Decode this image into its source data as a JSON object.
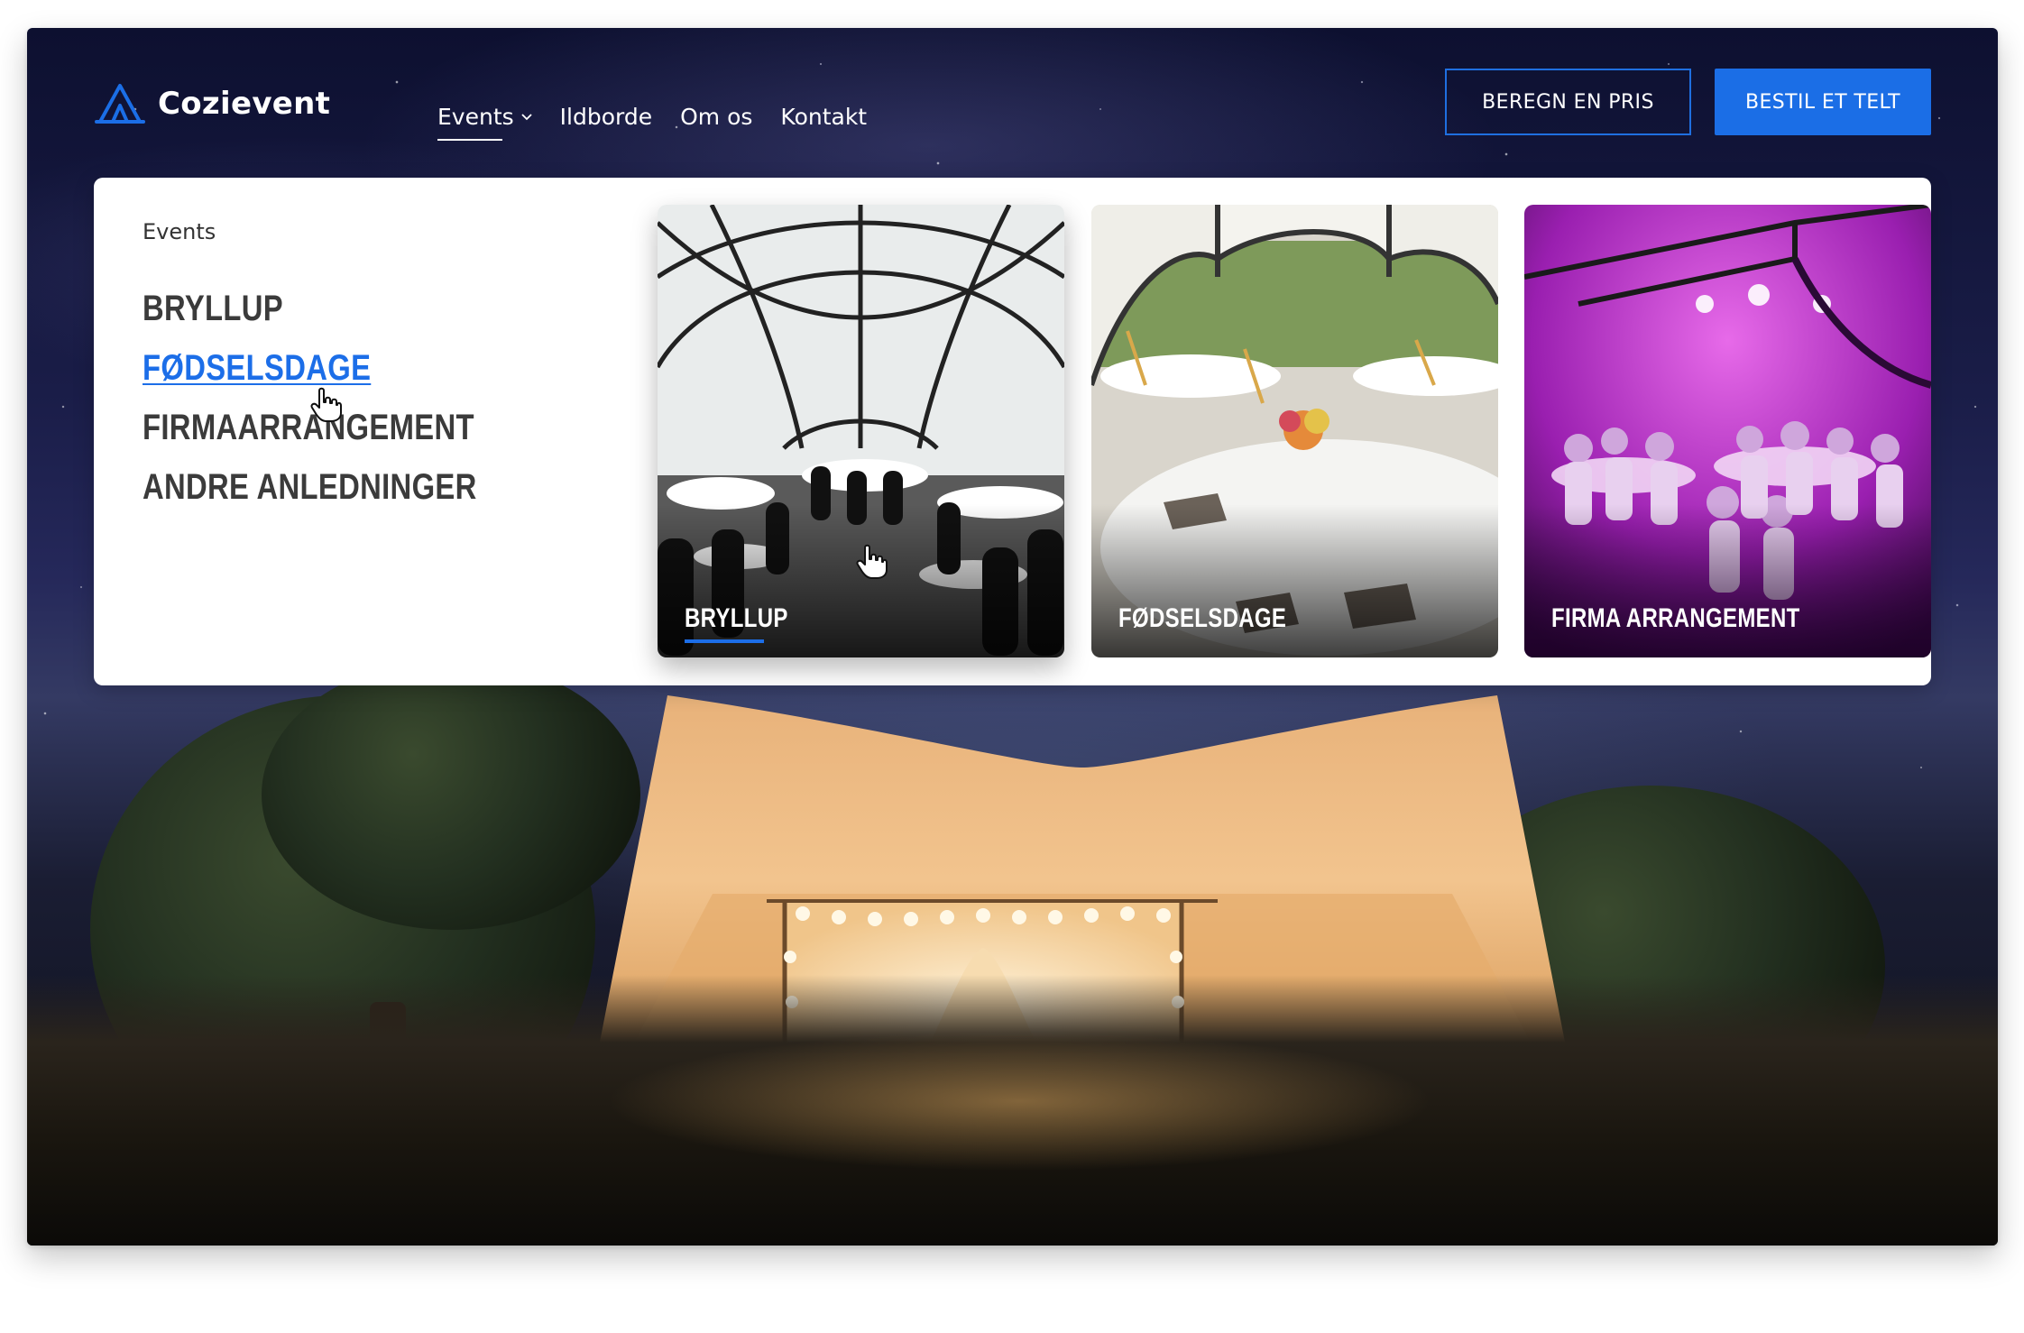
{
  "brand": {
    "name": "Cozievent",
    "logo_icon": "tent-logo-icon",
    "accent_color": "#1b6ee6"
  },
  "nav": {
    "items": [
      {
        "label": "Events",
        "active": true,
        "has_dropdown": true
      },
      {
        "label": "Ildborde"
      },
      {
        "label": "Om os"
      },
      {
        "label": "Kontakt"
      }
    ]
  },
  "actions": {
    "price_label": "BEREGN EN PRIS",
    "order_label": "BESTIL ET TELT"
  },
  "dropdown": {
    "heading": "Events",
    "links": [
      {
        "label": "BRYLLUP"
      },
      {
        "label": "FØDSELSDAGE",
        "hover": true
      },
      {
        "label": "FIRMAARRANGEMENT"
      },
      {
        "label": "ANDRE ANLEDNINGER"
      }
    ],
    "cards": [
      {
        "label": "BRYLLUP",
        "active": true
      },
      {
        "label": "FØDSELSDAGE"
      },
      {
        "label": "FIRMA ARRANGEMENT"
      }
    ]
  }
}
